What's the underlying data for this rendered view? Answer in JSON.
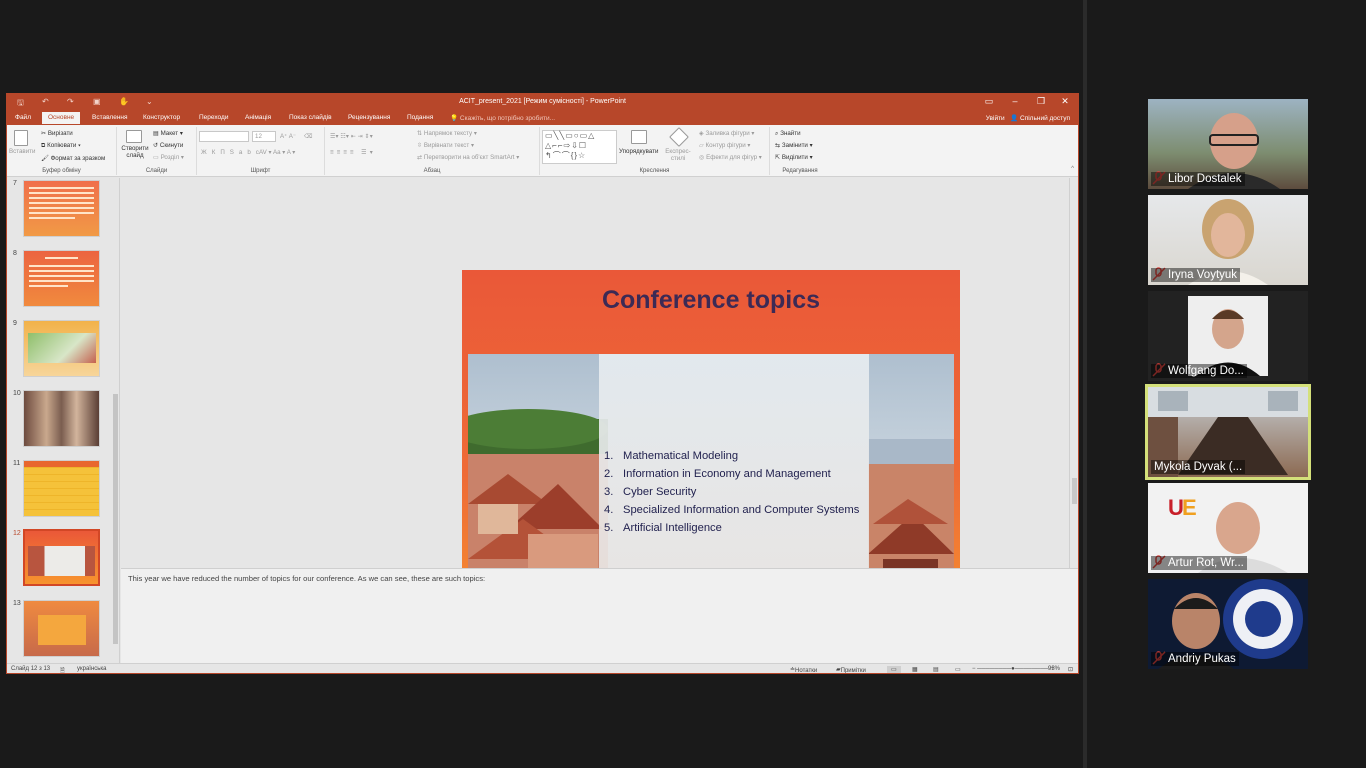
{
  "window": {
    "doc_title": "ACIT_present_2021 [Режим сумісності] - PowerPoint",
    "minimize": "–",
    "maximize": "❐",
    "close": "✕"
  },
  "ribbon_tabs": [
    "Файл",
    "Основне",
    "Вставлення",
    "Конструктор",
    "Переходи",
    "Анімація",
    "Показ слайдів",
    "Рецензування",
    "Подання"
  ],
  "tell_me": "Скажіть, що потрібно зробити...",
  "account": {
    "signin": "Увійти",
    "share": "Спільний доступ"
  },
  "ribbon": {
    "clipboard": {
      "paste": "Вставити",
      "cut": "Вирізати",
      "copy": "Копіювати",
      "format_painter": "Формат за зразком",
      "group": "Буфер обміну"
    },
    "slides": {
      "new_slide": "Створити слайд",
      "layout": "Макет",
      "reset": "Скинути",
      "section": "Розділ",
      "group": "Слайди"
    },
    "font": {
      "font_size": "12",
      "group": "Шрифт"
    },
    "paragraph": {
      "text_direction": "Напрямок тексту",
      "align_text": "Вирівнати текст",
      "convert_smartart": "Перетворити на об'єкт SmartArt",
      "group": "Абзац"
    },
    "drawing": {
      "arrange": "Упорядкувати",
      "quick_styles": "Експрес-стилі",
      "shape_fill": "Заливка фігури",
      "shape_outline": "Контур фігури",
      "shape_effects": "Ефекти для фігур",
      "group": "Креслення"
    },
    "editing": {
      "find": "Знайти",
      "replace": "Замінити",
      "select": "Виділити",
      "group": "Редагування"
    }
  },
  "thumbnails": [
    {
      "num": "7",
      "selected": false
    },
    {
      "num": "8",
      "selected": false
    },
    {
      "num": "9",
      "selected": false
    },
    {
      "num": "10",
      "selected": false
    },
    {
      "num": "11",
      "selected": false
    },
    {
      "num": "12",
      "selected": true
    },
    {
      "num": "13",
      "selected": false
    }
  ],
  "slide": {
    "title": "Conference topics",
    "topics": [
      {
        "num": "1.",
        "text": "Mathematical Modeling"
      },
      {
        "num": "2.",
        "text": "Information in Economy and Management"
      },
      {
        "num": "3.",
        "text": "Cyber Security"
      },
      {
        "num": "4.",
        "text": "Specialized Information and Computer Systems"
      },
      {
        "num": "5.",
        "text": "Artificial Intelligence"
      }
    ]
  },
  "notes": "This year we have reduced the number of topics for our conference. As we can see, these are such topics:",
  "status": {
    "slide_counter": "Слайд 12 з 13",
    "language": "українська",
    "notes_btn": "Нотатки",
    "comments_btn": "Примітки",
    "zoom": "93%"
  },
  "participants": [
    {
      "name": "Libor Dostalek",
      "muted": true,
      "active": false
    },
    {
      "name": "Iryna Voytyuk",
      "muted": true,
      "active": false
    },
    {
      "name": "Wolfgang Do...",
      "muted": true,
      "active": false
    },
    {
      "name": "Mykola Dyvak (...",
      "muted": false,
      "active": true
    },
    {
      "name": "Artur Rot, Wr...",
      "muted": true,
      "active": false
    },
    {
      "name": "Andriy Pukas",
      "muted": true,
      "active": false
    }
  ],
  "colors": {
    "ppt_accent": "#b7472a",
    "slide_title": "#3c2a55",
    "active_speaker": "#d4e07a",
    "mute_icon": "#e0443e"
  }
}
